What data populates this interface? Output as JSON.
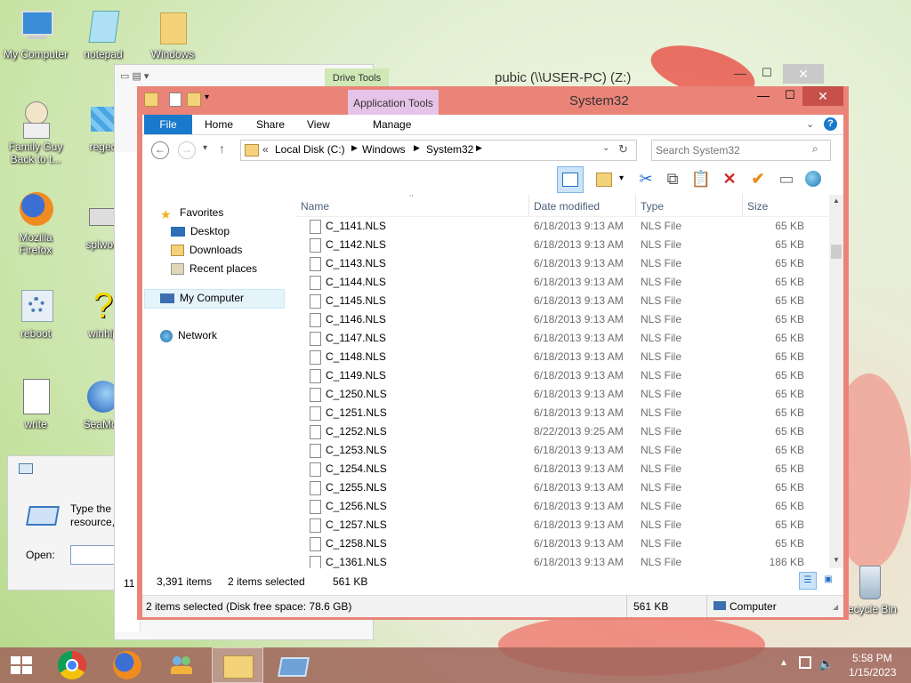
{
  "desktop": {
    "icons": [
      {
        "label": "My Computer"
      },
      {
        "label": "notepad"
      },
      {
        "label": "Windows"
      },
      {
        "label": "Family Guy Back to t..."
      },
      {
        "label": "reged"
      },
      {
        "label": "Mozilla Firefox"
      },
      {
        "label": "splwow"
      },
      {
        "label": "reboot"
      },
      {
        "label": "winhlp"
      },
      {
        "label": "write"
      },
      {
        "label": "SeaMon"
      },
      {
        "label": "Recycle Bin"
      }
    ]
  },
  "run_dialog": {
    "text_line1": "Type the",
    "text_line2": "resource,",
    "open_label": "Open:",
    "side_num": "1",
    "bottom_num": "11"
  },
  "back_window": {
    "context_tab": "Drive Tools",
    "title": "pubic (\\\\USER-PC) (Z:)"
  },
  "explorer": {
    "context_tab": "Application Tools",
    "title": "System32",
    "tabs": [
      "File",
      "Home",
      "Share",
      "View",
      "Manage"
    ],
    "breadcrumb": {
      "prefix": "«",
      "parts": [
        "Local Disk (C:)",
        "Windows",
        "System32"
      ]
    },
    "search_placeholder": "Search System32",
    "nav": {
      "favorites": "Favorites",
      "desktop": "Desktop",
      "downloads": "Downloads",
      "recent": "Recent places",
      "computer": "My Computer",
      "network": "Network"
    },
    "columns": {
      "name": "Name",
      "date": "Date modified",
      "type": "Type",
      "size": "Size"
    },
    "files": [
      {
        "name": "C_1141.NLS",
        "date": "6/18/2013 9:13 AM",
        "type": "NLS File",
        "size": "65 KB"
      },
      {
        "name": "C_1142.NLS",
        "date": "6/18/2013 9:13 AM",
        "type": "NLS File",
        "size": "65 KB"
      },
      {
        "name": "C_1143.NLS",
        "date": "6/18/2013 9:13 AM",
        "type": "NLS File",
        "size": "65 KB"
      },
      {
        "name": "C_1144.NLS",
        "date": "6/18/2013 9:13 AM",
        "type": "NLS File",
        "size": "65 KB"
      },
      {
        "name": "C_1145.NLS",
        "date": "6/18/2013 9:13 AM",
        "type": "NLS File",
        "size": "65 KB"
      },
      {
        "name": "C_1146.NLS",
        "date": "6/18/2013 9:13 AM",
        "type": "NLS File",
        "size": "65 KB"
      },
      {
        "name": "C_1147.NLS",
        "date": "6/18/2013 9:13 AM",
        "type": "NLS File",
        "size": "65 KB"
      },
      {
        "name": "C_1148.NLS",
        "date": "6/18/2013 9:13 AM",
        "type": "NLS File",
        "size": "65 KB"
      },
      {
        "name": "C_1149.NLS",
        "date": "6/18/2013 9:13 AM",
        "type": "NLS File",
        "size": "65 KB"
      },
      {
        "name": "C_1250.NLS",
        "date": "6/18/2013 9:13 AM",
        "type": "NLS File",
        "size": "65 KB"
      },
      {
        "name": "C_1251.NLS",
        "date": "6/18/2013 9:13 AM",
        "type": "NLS File",
        "size": "65 KB"
      },
      {
        "name": "C_1252.NLS",
        "date": "8/22/2013 9:25 AM",
        "type": "NLS File",
        "size": "65 KB"
      },
      {
        "name": "C_1253.NLS",
        "date": "6/18/2013 9:13 AM",
        "type": "NLS File",
        "size": "65 KB"
      },
      {
        "name": "C_1254.NLS",
        "date": "6/18/2013 9:13 AM",
        "type": "NLS File",
        "size": "65 KB"
      },
      {
        "name": "C_1255.NLS",
        "date": "6/18/2013 9:13 AM",
        "type": "NLS File",
        "size": "65 KB"
      },
      {
        "name": "C_1256.NLS",
        "date": "6/18/2013 9:13 AM",
        "type": "NLS File",
        "size": "65 KB"
      },
      {
        "name": "C_1257.NLS",
        "date": "6/18/2013 9:13 AM",
        "type": "NLS File",
        "size": "65 KB"
      },
      {
        "name": "C_1258.NLS",
        "date": "6/18/2013 9:13 AM",
        "type": "NLS File",
        "size": "65 KB"
      },
      {
        "name": "C_1361.NLS",
        "date": "6/18/2013 9:13 AM",
        "type": "NLS File",
        "size": "186 KB"
      }
    ],
    "status": {
      "items": "3,391 items",
      "selected": "2 items selected",
      "selected_size": "561 KB"
    },
    "details_bar": {
      "left": "2 items selected (Disk free space: 78.6 GB)",
      "size": "561 KB",
      "location": "Computer"
    },
    "accent_color": "#ea8478"
  },
  "taskbar": {
    "time": "5:58 PM",
    "date": "1/15/2023"
  }
}
